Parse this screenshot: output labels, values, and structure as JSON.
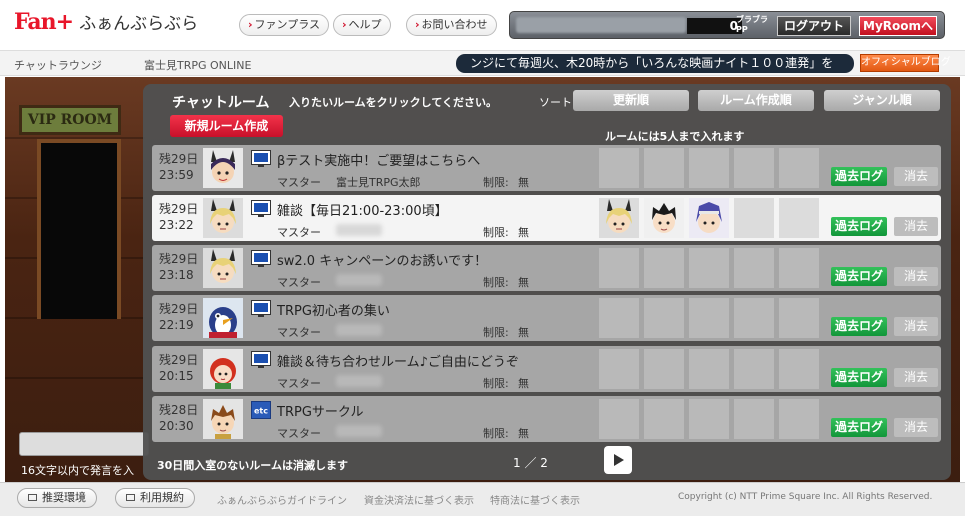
{
  "header": {
    "brand": "Fan+",
    "brand_sub": "ふぁんぶらぶら",
    "nav": [
      {
        "label": "ファンプラス"
      },
      {
        "label": "ヘルプ"
      },
      {
        "label": "お問い合わせ"
      }
    ],
    "account": {
      "pp_count": "0",
      "pp_label_1": "ブラブラ",
      "pp_label_2": "PP",
      "logout_label": "ログアウト",
      "myroom_label": "MyRoomへ"
    }
  },
  "subbar": {
    "crumb_lounge": "チャットラウンジ",
    "crumb_room": "富士見TRPG ONLINE",
    "ticker": "ンジにて毎週火、木20時から「いろんな映画ナイト１００連発」を",
    "official_blog": "オフィシャルブログ"
  },
  "scene": {
    "vip_sign": "VIP ROOM",
    "input_hint": "16文字以内で発言を入"
  },
  "panel": {
    "title": "チャットルーム",
    "instruction": "入りたいルームをクリックしてください。",
    "sort_label": "ソート",
    "sort_buttons": [
      "更新順",
      "ルーム作成順",
      "ジャンル順"
    ],
    "new_room_label": "新規ルーム作成",
    "capacity_note": "ルームには5人まで入れます",
    "vanish_note": "30日間入室のないルームは消滅します",
    "page_indicator": "1 ／ 2",
    "labels": {
      "master": "マスター",
      "limit": "制限:",
      "log": "過去ログ",
      "delete": "消去"
    },
    "rooms": [
      {
        "date": "残29日",
        "time": "23:59",
        "icon": "monitor-icon",
        "title": "βテスト実施中！ご要望はこちらへ",
        "master": "富士見TRPG太郎",
        "limit": "無",
        "avatar": "girl-bunny-ears-avatar",
        "selected": false
      },
      {
        "date": "残29日",
        "time": "23:22",
        "icon": "monitor-icon",
        "title": "雑談【毎日21:00-23:00頃】",
        "master": "",
        "limit": "無",
        "avatar": "blonde-bunny-ears-avatar",
        "selected": true,
        "occupants": [
          "blonde-bunny-ears-avatar",
          "black-hair-boy-avatar",
          "blue-hair-headband-avatar"
        ]
      },
      {
        "date": "残29日",
        "time": "23:18",
        "icon": "monitor-icon",
        "title": "sw2.0 キャンペーンのお誘いです！",
        "master": "",
        "limit": "無",
        "avatar": "blonde-bunny-ears-avatar",
        "selected": false
      },
      {
        "date": "残29日",
        "time": "22:19",
        "icon": "monitor-icon",
        "title": "TRPG初心者の集い",
        "master": "",
        "limit": "無",
        "avatar": "penguin-avatar",
        "selected": false
      },
      {
        "date": "残29日",
        "time": "20:15",
        "icon": "monitor-icon",
        "title": "雑談＆待ち合わせルーム♪ご自由にどうぞ",
        "master": "",
        "limit": "無",
        "avatar": "red-hair-avatar",
        "selected": false
      },
      {
        "date": "残28日",
        "time": "20:30",
        "icon": "etc-icon",
        "title": "TRPGサークル",
        "master": "",
        "limit": "無",
        "avatar": "brown-hair-boy-avatar",
        "selected": false
      }
    ]
  },
  "footer": {
    "buttons": [
      "推奨環境",
      "利用規約"
    ],
    "links": [
      "ふぁんぶらぶらガイドライン",
      "資金決済法に基づく表示",
      "特商法に基づく表示"
    ],
    "copyright": "Copyright (c) NTT Prime Square Inc. All Rights Reserved."
  }
}
